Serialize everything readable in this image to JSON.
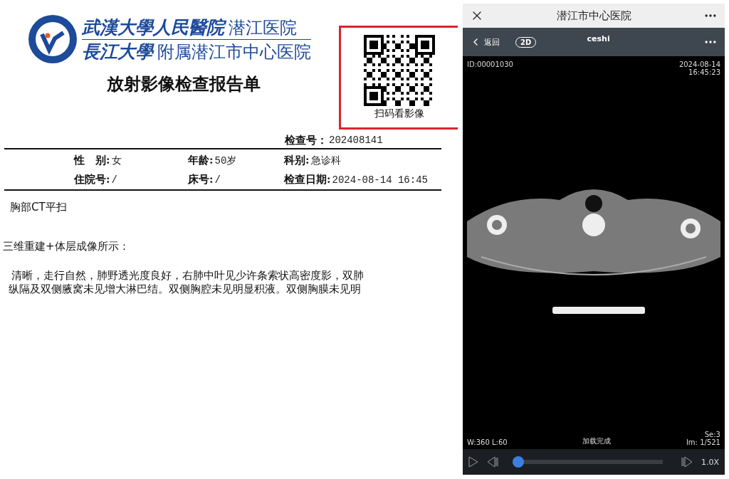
{
  "report": {
    "header": {
      "line_1": {
        "calligraphy": "武漢大學人民醫院",
        "print": "潜江医院"
      },
      "line_2": {
        "calligraphy": "長江大學",
        "print": "附属潜江市中心医院"
      }
    },
    "title": "放射影像检查报告单",
    "qr": {
      "caption": "扫码看影像"
    },
    "exam_no": {
      "label": "检查号：",
      "value": "202408141"
    },
    "fields": [
      {
        "label": "性　别:",
        "value": "女"
      },
      {
        "label": "年龄:",
        "value": "50岁"
      },
      {
        "label": "科别:",
        "value": "急诊科"
      },
      {
        "label": "住院号:",
        "value": "/"
      },
      {
        "label": "床号:",
        "value": "/"
      },
      {
        "label": "检查日期:",
        "value": "2024-08-14 16:45"
      }
    ],
    "exam_item": "胸部CT平扫",
    "method": "三维重建+体层成像所示：",
    "findings": [
      "清晰，走行自然，肺野透光度良好，右肺中叶见少许条索状高密度影，双肺",
      "纵隔及双侧腋窝未见增大淋巴结。双侧胸腔未见明显积液。双侧胸膜未见明"
    ]
  },
  "phone": {
    "title": "潜江市中心医院",
    "toolbar": {
      "back": "返回",
      "mode": "2D",
      "name": "ceshi"
    },
    "overlay": {
      "id": "ID:00001030",
      "date": "2024-08-14",
      "time": "16:45:23",
      "window": "W:360 L:60",
      "status": "加载完成",
      "series": "Se:3",
      "image": "Im: 1/521"
    },
    "player": {
      "level": 0,
      "speed": "1.0X"
    }
  }
}
